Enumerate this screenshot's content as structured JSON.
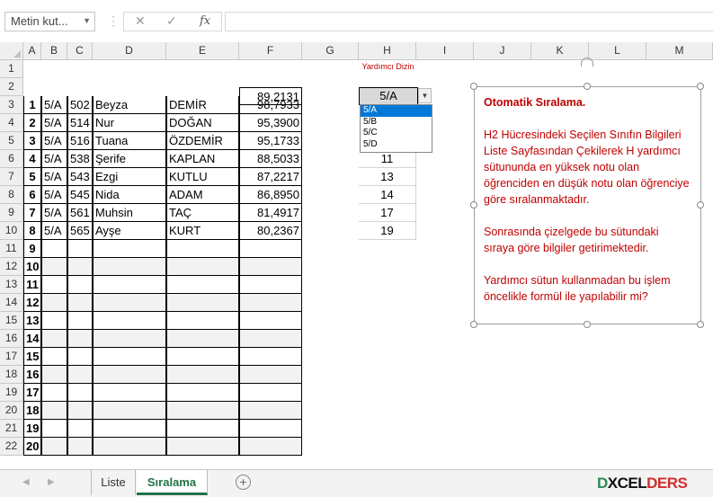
{
  "formula_bar": {
    "name_box": "Metin kut...",
    "cancel_icon": "✕",
    "enter_icon": "✓",
    "fx_label": "fx",
    "content": ""
  },
  "columns": [
    "A",
    "B",
    "C",
    "D",
    "E",
    "F",
    "G",
    "H",
    "I",
    "J",
    "K",
    "L",
    "M"
  ],
  "row_numbers": [
    "1",
    "2",
    "3",
    "4",
    "5",
    "6",
    "7",
    "8",
    "9",
    "10",
    "11",
    "12",
    "13",
    "14",
    "15",
    "16",
    "17",
    "18",
    "19",
    "20",
    "21",
    "22"
  ],
  "helper": {
    "header": "Yardımcı Dizin",
    "values": [
      "11",
      "13",
      "14",
      "17",
      "19"
    ]
  },
  "f2_value": "89,2131",
  "students": [
    {
      "no": "1",
      "sinif": "5/A",
      "numara": "502",
      "ad": "Beyza",
      "soyad": "DEMİR",
      "not": "98,7933"
    },
    {
      "no": "2",
      "sinif": "5/A",
      "numara": "514",
      "ad": "Nur",
      "soyad": "DOĞAN",
      "not": "95,3900"
    },
    {
      "no": "3",
      "sinif": "5/A",
      "numara": "516",
      "ad": "Tuana",
      "soyad": "ÖZDEMİR",
      "not": "95,1733"
    },
    {
      "no": "4",
      "sinif": "5/A",
      "numara": "538",
      "ad": "Şerife",
      "soyad": "KAPLAN",
      "not": "88,5033"
    },
    {
      "no": "5",
      "sinif": "5/A",
      "numara": "543",
      "ad": "Ezgi",
      "soyad": "KUTLU",
      "not": "87,2217"
    },
    {
      "no": "6",
      "sinif": "5/A",
      "numara": "545",
      "ad": "Nida",
      "soyad": "ADAM",
      "not": "86,8950"
    },
    {
      "no": "7",
      "sinif": "5/A",
      "numara": "561",
      "ad": "Muhsin",
      "soyad": "TAÇ",
      "not": "81,4917"
    },
    {
      "no": "8",
      "sinif": "5/A",
      "numara": "565",
      "ad": "Ayşe",
      "soyad": "KURT",
      "not": "80,2367"
    }
  ],
  "empty_row_numbers": [
    "9",
    "10",
    "11",
    "12",
    "13",
    "14",
    "15",
    "16",
    "17",
    "18",
    "19",
    "20"
  ],
  "dropdown": {
    "selected": "5/A",
    "options": [
      "5/A",
      "5/B",
      "5/C",
      "5/D"
    ]
  },
  "note": {
    "title": "Otomatik Sıralama.",
    "para1": "H2 Hücresindeki Seçilen Sınıfın Bilgileri Liste Sayfasından Çekilerek H yardımcı sütununda en yüksek notu olan öğrenciden en düşük notu olan öğrenciye göre sıralanmaktadır.",
    "para2": "Sonrasında çizelgede bu sütundaki sıraya göre bilgiler getirimektedir.",
    "para3": "Yardımcı sütun kullanmadan bu işlem öncelikle formül ile yapılabilir mi?"
  },
  "sheet_tabs": [
    "Liste",
    "Sıralama"
  ],
  "add_sheet": "+",
  "logo": {
    "part1": "D",
    "part2": "XCEL",
    "part3": "DERS"
  },
  "colors": {
    "accent_green": "#217346",
    "note_text": "#c00000",
    "dropdown_selection": "#0078d7"
  }
}
